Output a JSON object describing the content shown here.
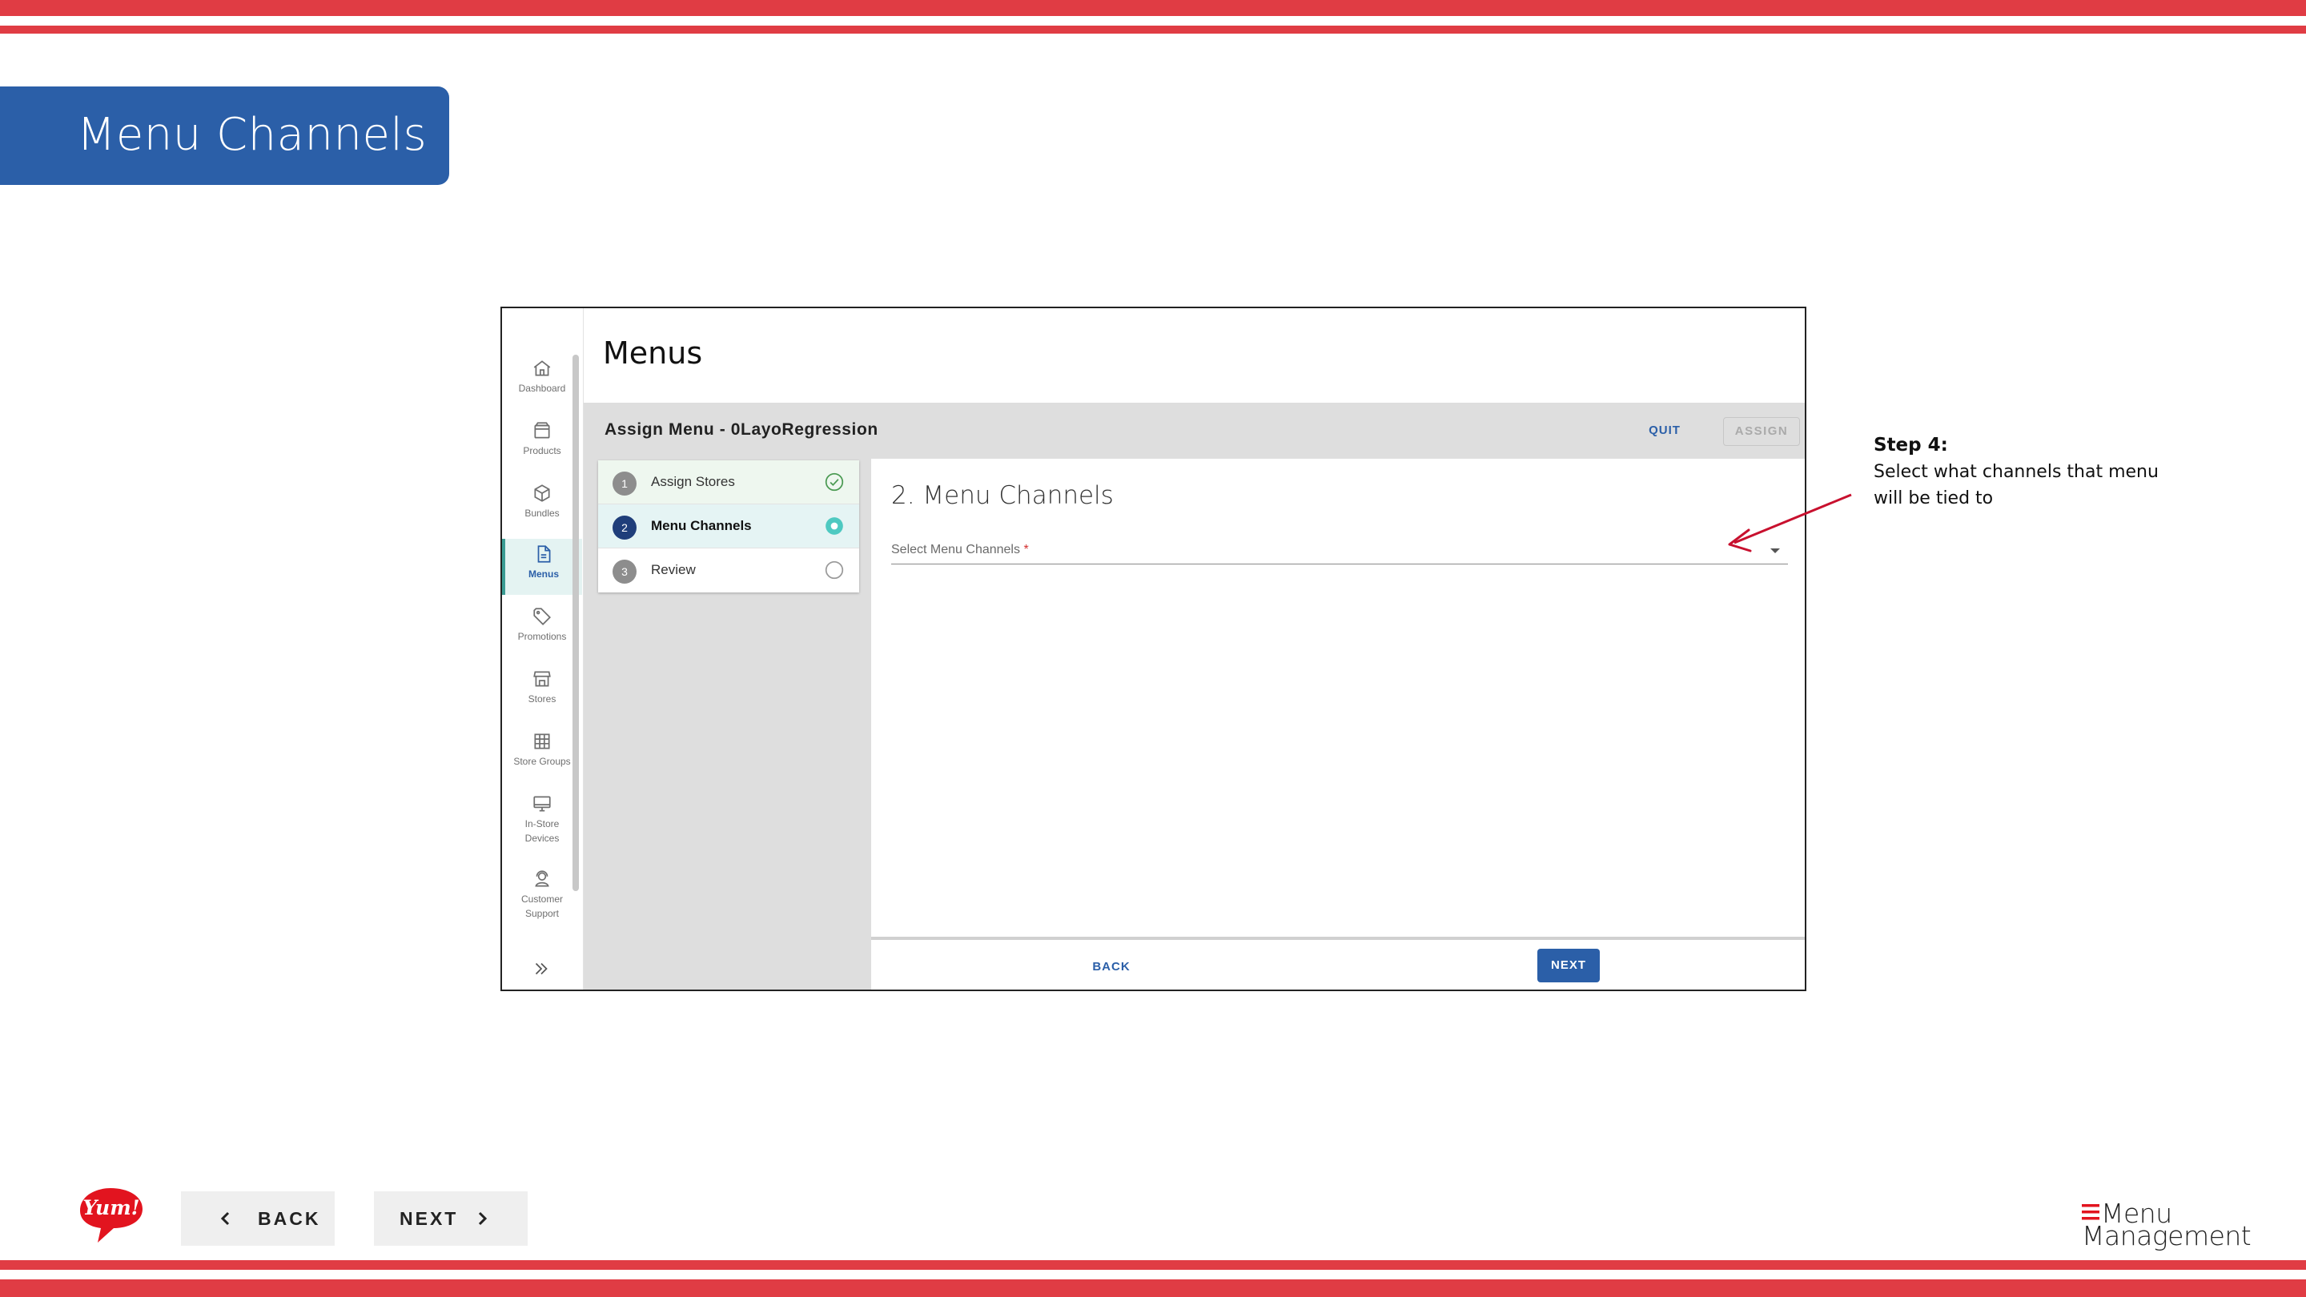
{
  "slide": {
    "title": "Menu Channels",
    "accent_color": "#e03c44",
    "title_color": "#2b5fa8"
  },
  "app": {
    "page_title": "Menus",
    "sidebar": {
      "items": [
        {
          "label": "Dashboard",
          "icon": "home-icon"
        },
        {
          "label": "Products",
          "icon": "box-icon"
        },
        {
          "label": "Bundles",
          "icon": "cube-icon"
        },
        {
          "label": "Menus",
          "icon": "document-icon",
          "active": true
        },
        {
          "label": "Promotions",
          "icon": "tag-icon"
        },
        {
          "label": "Stores",
          "icon": "storefront-icon"
        },
        {
          "label": "Store Groups",
          "icon": "grid-icon"
        },
        {
          "label": "In-Store Devices",
          "label_line1": "In-Store",
          "label_line2": "Devices",
          "icon": "monitor-icon"
        },
        {
          "label": "Customer Support",
          "label_line1": "Customer",
          "label_line2": "Support",
          "icon": "support-agent-icon"
        }
      ],
      "expand_icon": "double-chevron-right-icon"
    },
    "header": {
      "title": "Assign Menu - 0LayoRegression",
      "quit_label": "QUIT",
      "assign_label": "ASSIGN"
    },
    "steps": [
      {
        "number": "1",
        "label": "Assign Stores",
        "status": "complete"
      },
      {
        "number": "2",
        "label": "Menu Channels",
        "status": "active"
      },
      {
        "number": "3",
        "label": "Review",
        "status": "pending"
      }
    ],
    "content": {
      "heading": "2. Menu Channels",
      "select_placeholder": "Select Menu Channels",
      "required_mark": "*",
      "back_label": "BACK",
      "next_label": "NEXT"
    }
  },
  "annotation": {
    "step_label": "Step 4:",
    "line1": "Select what channels that menu",
    "line2": "will be tied to",
    "arrow_color": "#c8102e"
  },
  "footer": {
    "logo_text": "Yum!",
    "back_label": "BACK",
    "next_label": "NEXT",
    "brand_line1": "Menu",
    "brand_line2": "Management"
  }
}
